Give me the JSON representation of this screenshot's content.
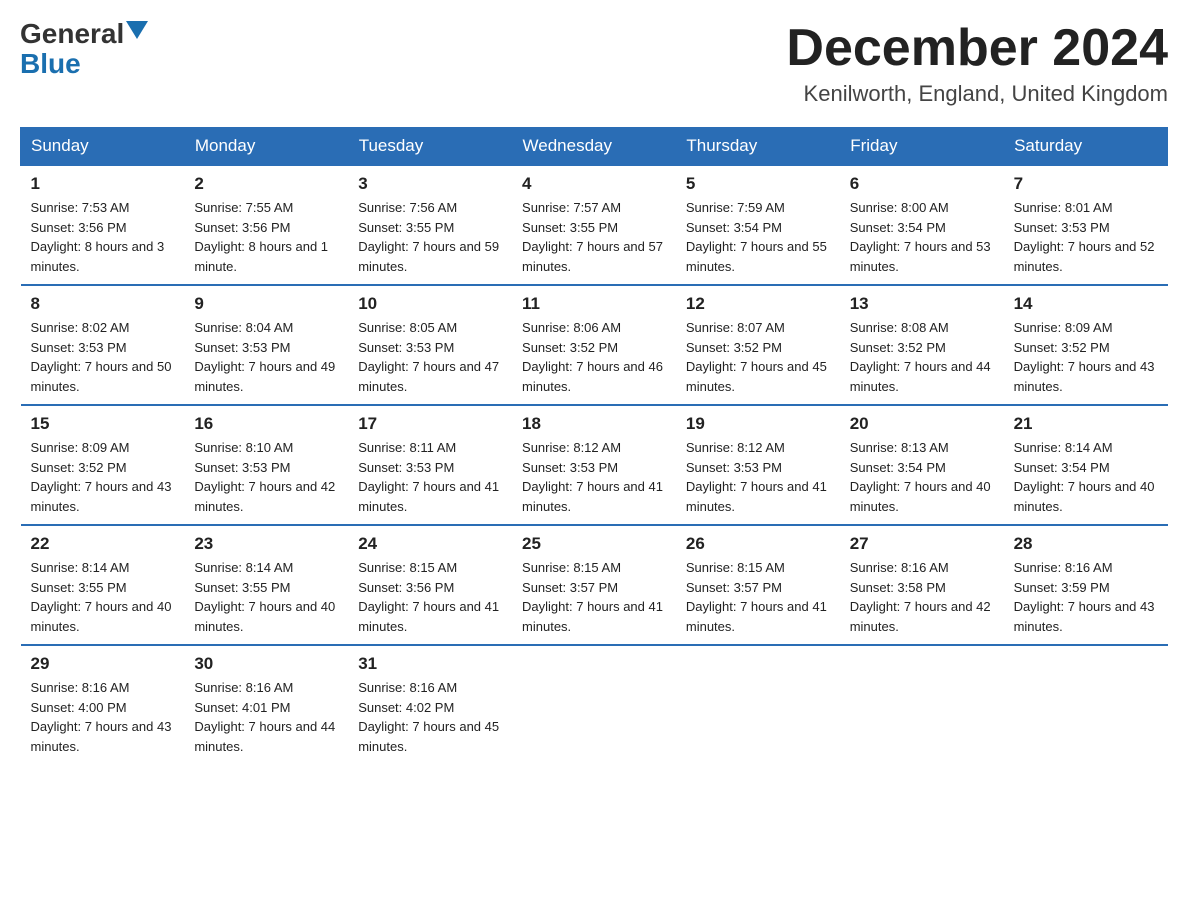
{
  "header": {
    "logo_general": "General",
    "logo_blue": "Blue",
    "month_title": "December 2024",
    "location": "Kenilworth, England, United Kingdom"
  },
  "days_of_week": [
    "Sunday",
    "Monday",
    "Tuesday",
    "Wednesday",
    "Thursday",
    "Friday",
    "Saturday"
  ],
  "weeks": [
    [
      {
        "day": "1",
        "sunrise": "7:53 AM",
        "sunset": "3:56 PM",
        "daylight": "8 hours and 3 minutes."
      },
      {
        "day": "2",
        "sunrise": "7:55 AM",
        "sunset": "3:56 PM",
        "daylight": "8 hours and 1 minute."
      },
      {
        "day": "3",
        "sunrise": "7:56 AM",
        "sunset": "3:55 PM",
        "daylight": "7 hours and 59 minutes."
      },
      {
        "day": "4",
        "sunrise": "7:57 AM",
        "sunset": "3:55 PM",
        "daylight": "7 hours and 57 minutes."
      },
      {
        "day": "5",
        "sunrise": "7:59 AM",
        "sunset": "3:54 PM",
        "daylight": "7 hours and 55 minutes."
      },
      {
        "day": "6",
        "sunrise": "8:00 AM",
        "sunset": "3:54 PM",
        "daylight": "7 hours and 53 minutes."
      },
      {
        "day": "7",
        "sunrise": "8:01 AM",
        "sunset": "3:53 PM",
        "daylight": "7 hours and 52 minutes."
      }
    ],
    [
      {
        "day": "8",
        "sunrise": "8:02 AM",
        "sunset": "3:53 PM",
        "daylight": "7 hours and 50 minutes."
      },
      {
        "day": "9",
        "sunrise": "8:04 AM",
        "sunset": "3:53 PM",
        "daylight": "7 hours and 49 minutes."
      },
      {
        "day": "10",
        "sunrise": "8:05 AM",
        "sunset": "3:53 PM",
        "daylight": "7 hours and 47 minutes."
      },
      {
        "day": "11",
        "sunrise": "8:06 AM",
        "sunset": "3:52 PM",
        "daylight": "7 hours and 46 minutes."
      },
      {
        "day": "12",
        "sunrise": "8:07 AM",
        "sunset": "3:52 PM",
        "daylight": "7 hours and 45 minutes."
      },
      {
        "day": "13",
        "sunrise": "8:08 AM",
        "sunset": "3:52 PM",
        "daylight": "7 hours and 44 minutes."
      },
      {
        "day": "14",
        "sunrise": "8:09 AM",
        "sunset": "3:52 PM",
        "daylight": "7 hours and 43 minutes."
      }
    ],
    [
      {
        "day": "15",
        "sunrise": "8:09 AM",
        "sunset": "3:52 PM",
        "daylight": "7 hours and 43 minutes."
      },
      {
        "day": "16",
        "sunrise": "8:10 AM",
        "sunset": "3:53 PM",
        "daylight": "7 hours and 42 minutes."
      },
      {
        "day": "17",
        "sunrise": "8:11 AM",
        "sunset": "3:53 PM",
        "daylight": "7 hours and 41 minutes."
      },
      {
        "day": "18",
        "sunrise": "8:12 AM",
        "sunset": "3:53 PM",
        "daylight": "7 hours and 41 minutes."
      },
      {
        "day": "19",
        "sunrise": "8:12 AM",
        "sunset": "3:53 PM",
        "daylight": "7 hours and 41 minutes."
      },
      {
        "day": "20",
        "sunrise": "8:13 AM",
        "sunset": "3:54 PM",
        "daylight": "7 hours and 40 minutes."
      },
      {
        "day": "21",
        "sunrise": "8:14 AM",
        "sunset": "3:54 PM",
        "daylight": "7 hours and 40 minutes."
      }
    ],
    [
      {
        "day": "22",
        "sunrise": "8:14 AM",
        "sunset": "3:55 PM",
        "daylight": "7 hours and 40 minutes."
      },
      {
        "day": "23",
        "sunrise": "8:14 AM",
        "sunset": "3:55 PM",
        "daylight": "7 hours and 40 minutes."
      },
      {
        "day": "24",
        "sunrise": "8:15 AM",
        "sunset": "3:56 PM",
        "daylight": "7 hours and 41 minutes."
      },
      {
        "day": "25",
        "sunrise": "8:15 AM",
        "sunset": "3:57 PM",
        "daylight": "7 hours and 41 minutes."
      },
      {
        "day": "26",
        "sunrise": "8:15 AM",
        "sunset": "3:57 PM",
        "daylight": "7 hours and 41 minutes."
      },
      {
        "day": "27",
        "sunrise": "8:16 AM",
        "sunset": "3:58 PM",
        "daylight": "7 hours and 42 minutes."
      },
      {
        "day": "28",
        "sunrise": "8:16 AM",
        "sunset": "3:59 PM",
        "daylight": "7 hours and 43 minutes."
      }
    ],
    [
      {
        "day": "29",
        "sunrise": "8:16 AM",
        "sunset": "4:00 PM",
        "daylight": "7 hours and 43 minutes."
      },
      {
        "day": "30",
        "sunrise": "8:16 AM",
        "sunset": "4:01 PM",
        "daylight": "7 hours and 44 minutes."
      },
      {
        "day": "31",
        "sunrise": "8:16 AM",
        "sunset": "4:02 PM",
        "daylight": "7 hours and 45 minutes."
      },
      null,
      null,
      null,
      null
    ]
  ]
}
